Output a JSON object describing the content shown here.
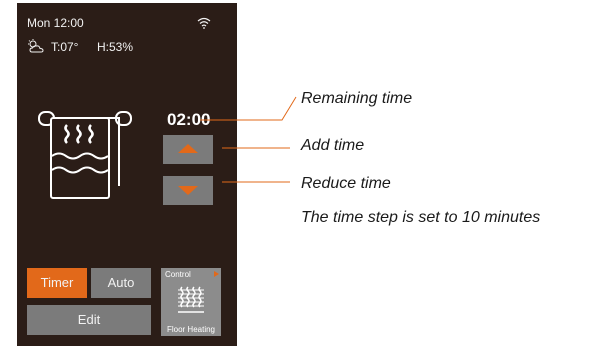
{
  "status": {
    "day_time": "Mon 12:00",
    "temperature": "T:07°",
    "humidity": "H:53%"
  },
  "icons": {
    "weather": "cloud-sun-icon",
    "wifi": "wifi-icon",
    "towel": "towel-rail-icon",
    "floor": "floor-heating-icon"
  },
  "timer": {
    "remaining": "02:00"
  },
  "tabs": [
    {
      "label": "Timer",
      "active": true
    },
    {
      "label": "Auto",
      "active": false
    }
  ],
  "edit_label": "Edit",
  "control_tile": {
    "title": "Control",
    "label": "Floor Heating"
  },
  "annotations": {
    "remaining": "Remaining time",
    "add": "Add time",
    "reduce": "Reduce time",
    "step": "The time step is set to 10 minutes"
  },
  "colors": {
    "device_bg": "#2b1d17",
    "accent": "#e2691a",
    "button": "#7b7b7b",
    "tile": "#8c8c8c"
  }
}
